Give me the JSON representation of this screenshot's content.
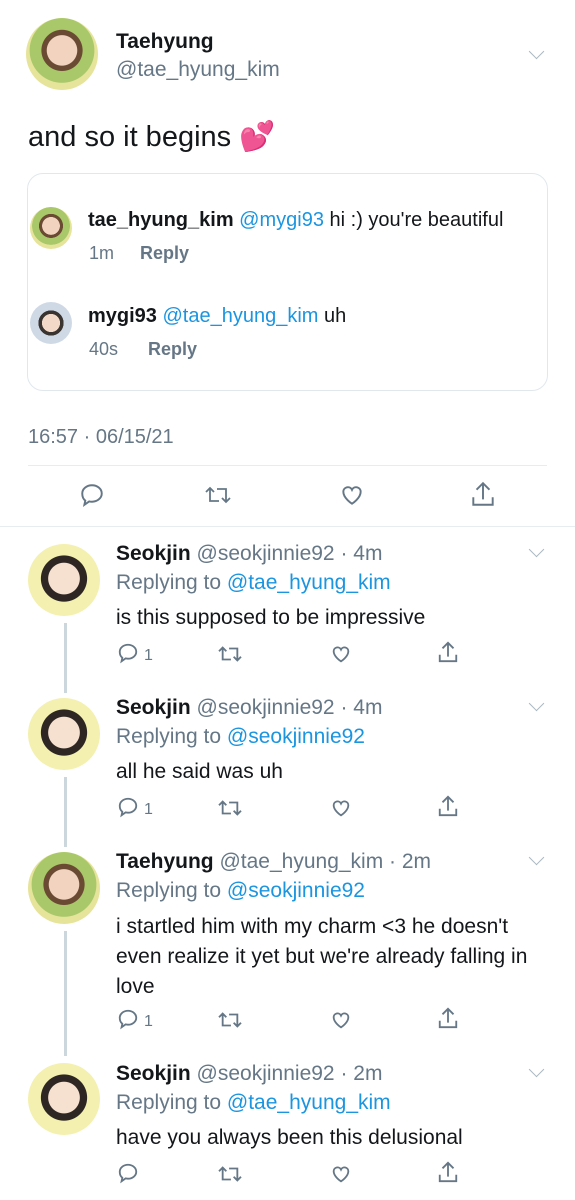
{
  "main_tweet": {
    "name": "Taehyung",
    "handle": "@tae_hyung_kim",
    "text": "and so it begins 💕",
    "timestamp": "16:57 · 06/15/21"
  },
  "quoted": [
    {
      "name": "tae_hyung_kim",
      "mention": "@mygi93",
      "text": " hi :) you're beautiful",
      "time": "1m",
      "reply": "Reply"
    },
    {
      "name": "mygi93",
      "mention": "@tae_hyung_kim",
      "text": " uh",
      "time": "40s",
      "reply": "Reply"
    }
  ],
  "replies": [
    {
      "name": "Seokjin",
      "meta": "@seokjinnie92 · 4m",
      "replying_prefix": "Replying to ",
      "replying_to": "@tae_hyung_kim",
      "text": "is this supposed to be impressive",
      "reply_count": "1"
    },
    {
      "name": "Seokjin",
      "meta": "@seokjinnie92 · 4m",
      "replying_prefix": "Replying to ",
      "replying_to": "@seokjinnie92",
      "text": "all he said was uh",
      "reply_count": "1"
    },
    {
      "name": "Taehyung",
      "meta": "@tae_hyung_kim · 2m",
      "replying_prefix": "Replying to ",
      "replying_to": "@seokjinnie92",
      "text": "i startled him with my charm <3 he doesn't even realize it yet but we're already falling in love",
      "reply_count": "1"
    },
    {
      "name": "Seokjin",
      "meta": "@seokjinnie92 · 2m",
      "replying_prefix": "Replying to ",
      "replying_to": "@tae_hyung_kim",
      "text": "have you always been this delusional",
      "reply_count": ""
    }
  ],
  "colors": {
    "accent": "#1b95e0",
    "secondary_text": "#657786",
    "divider": "#e6ecf0"
  }
}
